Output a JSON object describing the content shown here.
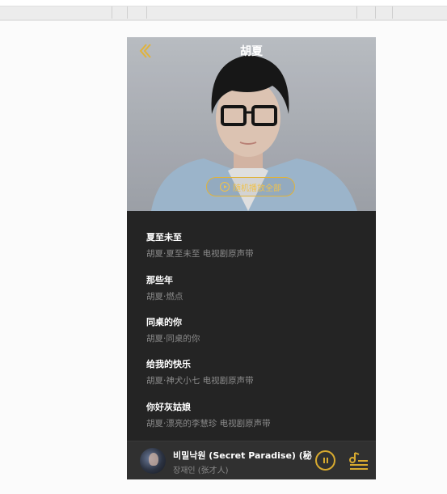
{
  "header": {
    "title": "胡夏",
    "back_icon": "back-chevron-icon",
    "play_all_label": "随机播放全部",
    "play_all_icon": "play-circle-icon"
  },
  "songs": [
    {
      "name": "夏至未至",
      "meta": "胡夏·夏至未至 电视剧原声带"
    },
    {
      "name": "那些年",
      "meta": "胡夏·燃点"
    },
    {
      "name": "同桌的你",
      "meta": "胡夏·同桌的你"
    },
    {
      "name": "给我的快乐",
      "meta": "胡夏·神犬小七 电视剧原声带"
    },
    {
      "name": "你好灰姑娘",
      "meta": "胡夏·漂亮的李慧珍 电视剧原声带"
    }
  ],
  "player": {
    "title": "비밀낙원 (Secret Paradise) (秘...",
    "artist": "장재인 (张才人)",
    "pause_icon": "pause-icon",
    "playlist_icon": "playlist-icon"
  },
  "colors": {
    "accent": "#e0b33b",
    "panel_bg": "#242424",
    "player_bg": "#303030",
    "muted_text": "#8a8a8a"
  }
}
